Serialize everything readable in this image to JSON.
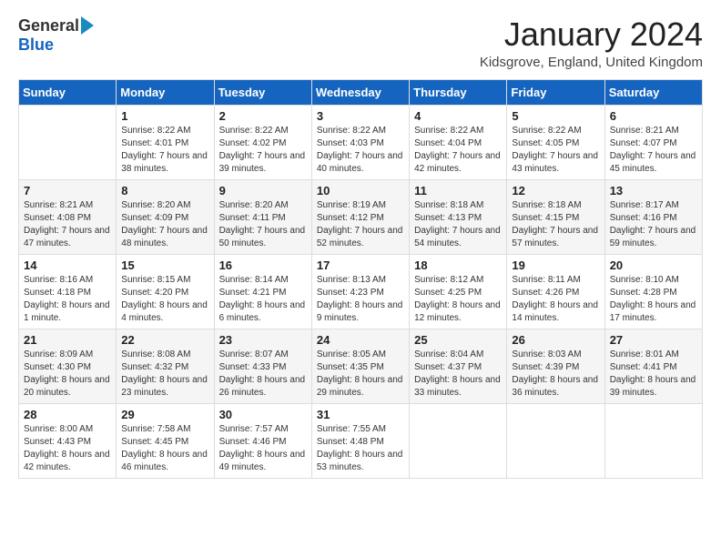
{
  "logo": {
    "general": "General",
    "blue": "Blue"
  },
  "header": {
    "month_title": "January 2024",
    "location": "Kidsgrove, England, United Kingdom"
  },
  "weekdays": [
    "Sunday",
    "Monday",
    "Tuesday",
    "Wednesday",
    "Thursday",
    "Friday",
    "Saturday"
  ],
  "weeks": [
    [
      {
        "day": "",
        "sunrise": "",
        "sunset": "",
        "daylight": ""
      },
      {
        "day": "1",
        "sunrise": "Sunrise: 8:22 AM",
        "sunset": "Sunset: 4:01 PM",
        "daylight": "Daylight: 7 hours and 38 minutes."
      },
      {
        "day": "2",
        "sunrise": "Sunrise: 8:22 AM",
        "sunset": "Sunset: 4:02 PM",
        "daylight": "Daylight: 7 hours and 39 minutes."
      },
      {
        "day": "3",
        "sunrise": "Sunrise: 8:22 AM",
        "sunset": "Sunset: 4:03 PM",
        "daylight": "Daylight: 7 hours and 40 minutes."
      },
      {
        "day": "4",
        "sunrise": "Sunrise: 8:22 AM",
        "sunset": "Sunset: 4:04 PM",
        "daylight": "Daylight: 7 hours and 42 minutes."
      },
      {
        "day": "5",
        "sunrise": "Sunrise: 8:22 AM",
        "sunset": "Sunset: 4:05 PM",
        "daylight": "Daylight: 7 hours and 43 minutes."
      },
      {
        "day": "6",
        "sunrise": "Sunrise: 8:21 AM",
        "sunset": "Sunset: 4:07 PM",
        "daylight": "Daylight: 7 hours and 45 minutes."
      }
    ],
    [
      {
        "day": "7",
        "sunrise": "Sunrise: 8:21 AM",
        "sunset": "Sunset: 4:08 PM",
        "daylight": "Daylight: 7 hours and 47 minutes."
      },
      {
        "day": "8",
        "sunrise": "Sunrise: 8:20 AM",
        "sunset": "Sunset: 4:09 PM",
        "daylight": "Daylight: 7 hours and 48 minutes."
      },
      {
        "day": "9",
        "sunrise": "Sunrise: 8:20 AM",
        "sunset": "Sunset: 4:11 PM",
        "daylight": "Daylight: 7 hours and 50 minutes."
      },
      {
        "day": "10",
        "sunrise": "Sunrise: 8:19 AM",
        "sunset": "Sunset: 4:12 PM",
        "daylight": "Daylight: 7 hours and 52 minutes."
      },
      {
        "day": "11",
        "sunrise": "Sunrise: 8:18 AM",
        "sunset": "Sunset: 4:13 PM",
        "daylight": "Daylight: 7 hours and 54 minutes."
      },
      {
        "day": "12",
        "sunrise": "Sunrise: 8:18 AM",
        "sunset": "Sunset: 4:15 PM",
        "daylight": "Daylight: 7 hours and 57 minutes."
      },
      {
        "day": "13",
        "sunrise": "Sunrise: 8:17 AM",
        "sunset": "Sunset: 4:16 PM",
        "daylight": "Daylight: 7 hours and 59 minutes."
      }
    ],
    [
      {
        "day": "14",
        "sunrise": "Sunrise: 8:16 AM",
        "sunset": "Sunset: 4:18 PM",
        "daylight": "Daylight: 8 hours and 1 minute."
      },
      {
        "day": "15",
        "sunrise": "Sunrise: 8:15 AM",
        "sunset": "Sunset: 4:20 PM",
        "daylight": "Daylight: 8 hours and 4 minutes."
      },
      {
        "day": "16",
        "sunrise": "Sunrise: 8:14 AM",
        "sunset": "Sunset: 4:21 PM",
        "daylight": "Daylight: 8 hours and 6 minutes."
      },
      {
        "day": "17",
        "sunrise": "Sunrise: 8:13 AM",
        "sunset": "Sunset: 4:23 PM",
        "daylight": "Daylight: 8 hours and 9 minutes."
      },
      {
        "day": "18",
        "sunrise": "Sunrise: 8:12 AM",
        "sunset": "Sunset: 4:25 PM",
        "daylight": "Daylight: 8 hours and 12 minutes."
      },
      {
        "day": "19",
        "sunrise": "Sunrise: 8:11 AM",
        "sunset": "Sunset: 4:26 PM",
        "daylight": "Daylight: 8 hours and 14 minutes."
      },
      {
        "day": "20",
        "sunrise": "Sunrise: 8:10 AM",
        "sunset": "Sunset: 4:28 PM",
        "daylight": "Daylight: 8 hours and 17 minutes."
      }
    ],
    [
      {
        "day": "21",
        "sunrise": "Sunrise: 8:09 AM",
        "sunset": "Sunset: 4:30 PM",
        "daylight": "Daylight: 8 hours and 20 minutes."
      },
      {
        "day": "22",
        "sunrise": "Sunrise: 8:08 AM",
        "sunset": "Sunset: 4:32 PM",
        "daylight": "Daylight: 8 hours and 23 minutes."
      },
      {
        "day": "23",
        "sunrise": "Sunrise: 8:07 AM",
        "sunset": "Sunset: 4:33 PM",
        "daylight": "Daylight: 8 hours and 26 minutes."
      },
      {
        "day": "24",
        "sunrise": "Sunrise: 8:05 AM",
        "sunset": "Sunset: 4:35 PM",
        "daylight": "Daylight: 8 hours and 29 minutes."
      },
      {
        "day": "25",
        "sunrise": "Sunrise: 8:04 AM",
        "sunset": "Sunset: 4:37 PM",
        "daylight": "Daylight: 8 hours and 33 minutes."
      },
      {
        "day": "26",
        "sunrise": "Sunrise: 8:03 AM",
        "sunset": "Sunset: 4:39 PM",
        "daylight": "Daylight: 8 hours and 36 minutes."
      },
      {
        "day": "27",
        "sunrise": "Sunrise: 8:01 AM",
        "sunset": "Sunset: 4:41 PM",
        "daylight": "Daylight: 8 hours and 39 minutes."
      }
    ],
    [
      {
        "day": "28",
        "sunrise": "Sunrise: 8:00 AM",
        "sunset": "Sunset: 4:43 PM",
        "daylight": "Daylight: 8 hours and 42 minutes."
      },
      {
        "day": "29",
        "sunrise": "Sunrise: 7:58 AM",
        "sunset": "Sunset: 4:45 PM",
        "daylight": "Daylight: 8 hours and 46 minutes."
      },
      {
        "day": "30",
        "sunrise": "Sunrise: 7:57 AM",
        "sunset": "Sunset: 4:46 PM",
        "daylight": "Daylight: 8 hours and 49 minutes."
      },
      {
        "day": "31",
        "sunrise": "Sunrise: 7:55 AM",
        "sunset": "Sunset: 4:48 PM",
        "daylight": "Daylight: 8 hours and 53 minutes."
      },
      {
        "day": "",
        "sunrise": "",
        "sunset": "",
        "daylight": ""
      },
      {
        "day": "",
        "sunrise": "",
        "sunset": "",
        "daylight": ""
      },
      {
        "day": "",
        "sunrise": "",
        "sunset": "",
        "daylight": ""
      }
    ]
  ]
}
